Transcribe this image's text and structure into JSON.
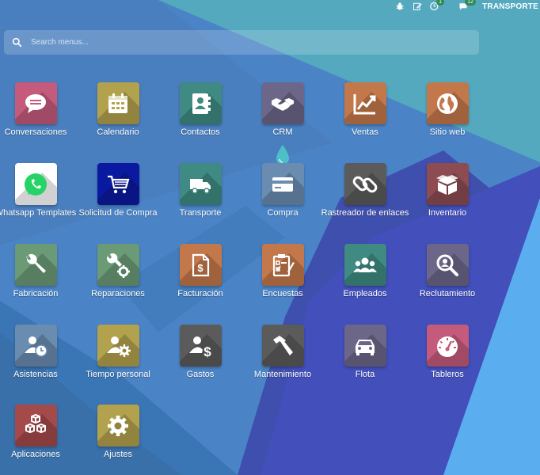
{
  "topbar": {
    "items": [
      {
        "icon": "bug-icon"
      },
      {
        "icon": "edit-icon"
      },
      {
        "icon": "activity-clock-icon",
        "badge": "1"
      },
      {
        "icon": "chat-icon",
        "badge": "12"
      }
    ],
    "company": "TRANSPORTE"
  },
  "search": {
    "placeholder": "Search menus..."
  },
  "apps": [
    {
      "label": "Conversaciones",
      "icon": "chat-bubble-icon",
      "color": "#c45b7c"
    },
    {
      "label": "Calendario",
      "icon": "calendar-icon",
      "color": "#b2a24e"
    },
    {
      "label": "Contactos",
      "icon": "address-book-icon",
      "color": "#3f8a83"
    },
    {
      "label": "CRM",
      "icon": "handshake-icon",
      "color": "#6c6789"
    },
    {
      "label": "Ventas",
      "icon": "sales-chart-icon",
      "color": "#c2784a"
    },
    {
      "label": "Sitio web",
      "icon": "globe-icon",
      "color": "#c2784a"
    },
    {
      "label": "Whatsapp Templates",
      "icon": "whatsapp-icon",
      "color": "#ffffff"
    },
    {
      "label": "Solicitud de Compra",
      "icon": "shopping-cart-icon",
      "color": "#0a1aa0"
    },
    {
      "label": "Transporte",
      "icon": "truck-icon",
      "color": "#3f8a83"
    },
    {
      "label": "Compra",
      "icon": "credit-card-icon",
      "color": "#6a8cb0"
    },
    {
      "label": "Rastreador de enlaces",
      "icon": "link-icon",
      "color": "#5b5b5b"
    },
    {
      "label": "Inventario",
      "icon": "box-icon",
      "color": "#8c4c52"
    },
    {
      "label": "Fabricación",
      "icon": "wrench-icon",
      "color": "#6b9a76"
    },
    {
      "label": "Reparaciones",
      "icon": "wrench-gear-icon",
      "color": "#6b9a76"
    },
    {
      "label": "Facturación",
      "icon": "invoice-icon",
      "color": "#c2784a"
    },
    {
      "label": "Encuestas",
      "icon": "survey-icon",
      "color": "#c2784a"
    },
    {
      "label": "Empleados",
      "icon": "people-icon",
      "color": "#3f8a83"
    },
    {
      "label": "Reclutamiento",
      "icon": "magnifier-user-icon",
      "color": "#6c6789"
    },
    {
      "label": "Asistencias",
      "icon": "user-clock-icon",
      "color": "#6a8cb0"
    },
    {
      "label": "Tiempo personal",
      "icon": "user-gear-icon",
      "color": "#b2a24e"
    },
    {
      "label": "Gastos",
      "icon": "user-dollar-icon",
      "color": "#5b5b5b"
    },
    {
      "label": "Mantenimiento",
      "icon": "hammer-icon",
      "color": "#5b5b5b"
    },
    {
      "label": "Flota",
      "icon": "car-icon",
      "color": "#6c6789"
    },
    {
      "label": "Tableros",
      "icon": "gauge-icon",
      "color": "#c45b7c"
    },
    {
      "label": "Aplicaciones",
      "icon": "cubes-icon",
      "color": "#a44a4a"
    },
    {
      "label": "Ajustes",
      "icon": "gear-icon",
      "color": "#b2a24e"
    }
  ]
}
